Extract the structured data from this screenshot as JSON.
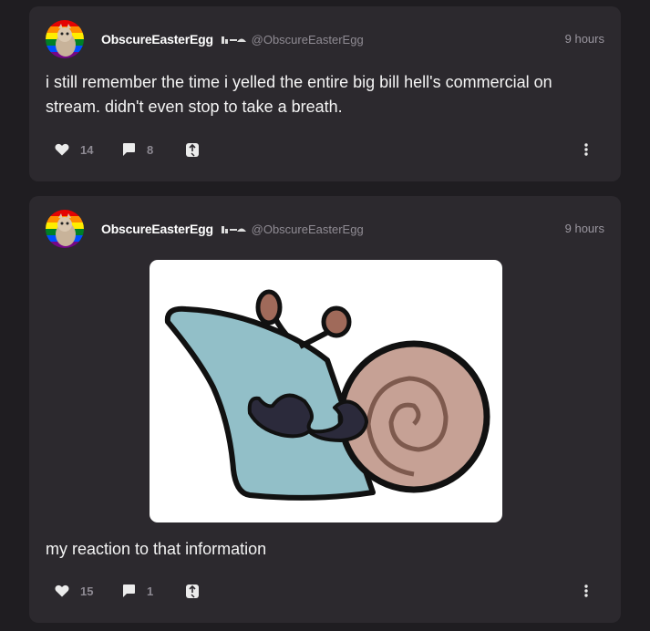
{
  "posts": [
    {
      "author": {
        "display_name": "ObscureEasterEgg",
        "handle": "@ObscureEasterEgg",
        "avatar_icon": "avatar-icon"
      },
      "time": "9 hours",
      "text": "i still remember the time i yelled the entire big bill hell's commercial on stream. didn't even stop to take a breath.",
      "likes": "14",
      "comments": "8"
    },
    {
      "author": {
        "display_name": "ObscureEasterEgg",
        "handle": "@ObscureEasterEgg",
        "avatar_icon": "avatar-icon"
      },
      "time": "9 hours",
      "image": {
        "icon": "snail-with-mustache-image"
      },
      "text": "my reaction to that information",
      "likes": "15",
      "comments": "1"
    }
  ],
  "icons": {
    "like": "heart-icon",
    "comment": "comment-bubble-icon",
    "share": "share-icon",
    "more": "more-vertical-icon",
    "badge": "badge-icon"
  },
  "colors": {
    "background": "#1f1d21",
    "card": "#2c292e",
    "muted": "#8f8b93"
  }
}
